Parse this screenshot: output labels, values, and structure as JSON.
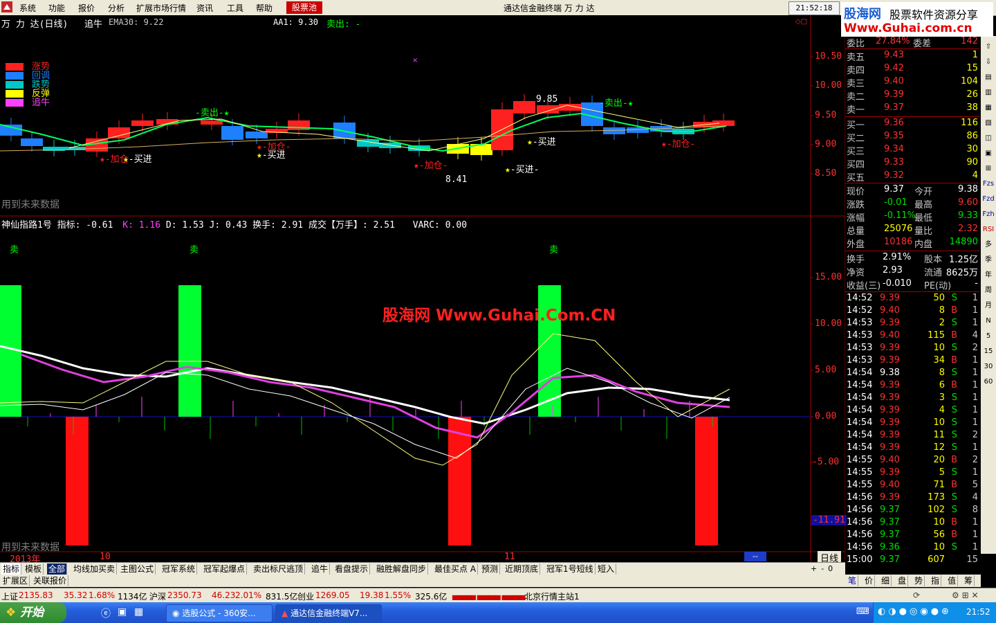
{
  "menu": {
    "items": [
      "系统",
      "功能",
      "报价",
      "分析",
      "扩展市场行情",
      "资讯",
      "工具",
      "帮助"
    ],
    "stock_pool": "股票池",
    "window_title": "通达信金融终端  万 力 达",
    "clock": "21:52:18",
    "logo_cn": "股海网",
    "logo_slogan": "股票软件资源分享",
    "logo_url": "Www.Guhai.com.cn"
  },
  "main_chart": {
    "stock_label": "万 力 达(日线)",
    "indicator_name": "追牛",
    "ema_label": "EMA30: 9.22",
    "aa1_label": "AA1: 9.30",
    "sell_label": "卖出: -",
    "future_data": "用到未来数据",
    "legend": [
      "涨势",
      "回调",
      "跌势",
      "反弹",
      "追牛"
    ],
    "legend_colors": [
      "#ff2020",
      "#1e7fff",
      "#00c8c8",
      "#ffff00",
      "#ff40ff"
    ],
    "annotations": {
      "high": "9.85",
      "low": "8.41",
      "sell": "卖出",
      "buy": "买进",
      "add": "加仓"
    },
    "y_ticks": [
      "10.50",
      "10.00",
      "9.50",
      "9.00",
      "8.50"
    ]
  },
  "sub_chart": {
    "title": "神仙指路1号",
    "indicator": "指标: -0.61",
    "k": "K: 1.16",
    "d": "D: 1.53",
    "j": "J: 0.43",
    "turnover": "换手: 2.91",
    "volume": "成交【万手】: 2.51",
    "varc": "VARC: 0.00",
    "sell_marker": "卖",
    "future_data": "用到未来数据",
    "watermark": "股海网 Www.Guhai.Com.CN",
    "y_ticks": [
      "15.00",
      "10.00",
      "5.00",
      "0.00",
      "-5.00"
    ],
    "current_value": "-11.91"
  },
  "x_axis": {
    "labels": [
      "2013年",
      "10",
      "11"
    ],
    "period": "日线"
  },
  "quote": {
    "weibi_label": "委比",
    "weibi": "27.84%",
    "weicha_label": "委差",
    "weicha": "142",
    "asks": [
      {
        "label": "卖五",
        "price": "9.43",
        "vol": "1"
      },
      {
        "label": "卖四",
        "price": "9.42",
        "vol": "15"
      },
      {
        "label": "卖三",
        "price": "9.40",
        "vol": "104"
      },
      {
        "label": "卖二",
        "price": "9.39",
        "vol": "26"
      },
      {
        "label": "卖一",
        "price": "9.37",
        "vol": "38"
      }
    ],
    "bids": [
      {
        "label": "买一",
        "price": "9.36",
        "vol": "116"
      },
      {
        "label": "买二",
        "price": "9.35",
        "vol": "86"
      },
      {
        "label": "买三",
        "price": "9.34",
        "vol": "30"
      },
      {
        "label": "买四",
        "price": "9.33",
        "vol": "90"
      },
      {
        "label": "买五",
        "price": "9.32",
        "vol": "4"
      }
    ],
    "stats": [
      {
        "l1": "现价",
        "v1": "9.37",
        "c1": "#ffffff",
        "l2": "今开",
        "v2": "9.38",
        "c2": "#ffffff"
      },
      {
        "l1": "涨跌",
        "v1": "-0.01",
        "c1": "#00e000",
        "l2": "最高",
        "v2": "9.60",
        "c2": "#ff3030"
      },
      {
        "l1": "涨幅",
        "v1": "-0.11%",
        "c1": "#00e000",
        "l2": "最低",
        "v2": "9.33",
        "c2": "#00e000"
      },
      {
        "l1": "总量",
        "v1": "25076",
        "c1": "#ffff00",
        "l2": "量比",
        "v2": "2.32",
        "c2": "#ff3030"
      },
      {
        "l1": "外盘",
        "v1": "10186",
        "c1": "#ff3030",
        "l2": "内盘",
        "v2": "14890",
        "c2": "#00e000"
      }
    ],
    "fund": [
      {
        "l1": "换手",
        "v1": "2.91%",
        "l2": "股本",
        "v2": "1.25亿"
      },
      {
        "l1": "净资",
        "v1": "2.93",
        "l2": "流通",
        "v2": "8625万"
      },
      {
        "l1": "收益(三)",
        "v1": "-0.010",
        "l2": "PE(动)",
        "v2": "-"
      }
    ]
  },
  "ticks": [
    {
      "t": "14:52",
      "p": "9.39",
      "v": "50",
      "s": "S",
      "n": "1"
    },
    {
      "t": "14:52",
      "p": "9.40",
      "v": "8",
      "s": "B",
      "n": "1"
    },
    {
      "t": "14:53",
      "p": "9.39",
      "v": "2",
      "s": "S",
      "n": "1"
    },
    {
      "t": "14:53",
      "p": "9.40",
      "v": "115",
      "s": "B",
      "n": "4"
    },
    {
      "t": "14:53",
      "p": "9.39",
      "v": "10",
      "s": "S",
      "n": "2"
    },
    {
      "t": "14:53",
      "p": "9.39",
      "v": "34",
      "s": "B",
      "n": "1"
    },
    {
      "t": "14:54",
      "p": "9.38",
      "v": "8",
      "s": "S",
      "n": "1"
    },
    {
      "t": "14:54",
      "p": "9.39",
      "v": "6",
      "s": "B",
      "n": "1"
    },
    {
      "t": "14:54",
      "p": "9.39",
      "v": "3",
      "s": "S",
      "n": "1"
    },
    {
      "t": "14:54",
      "p": "9.39",
      "v": "4",
      "s": "S",
      "n": "1"
    },
    {
      "t": "14:54",
      "p": "9.39",
      "v": "10",
      "s": "S",
      "n": "1"
    },
    {
      "t": "14:54",
      "p": "9.39",
      "v": "11",
      "s": "S",
      "n": "2"
    },
    {
      "t": "14:54",
      "p": "9.39",
      "v": "12",
      "s": "S",
      "n": "1"
    },
    {
      "t": "14:55",
      "p": "9.40",
      "v": "20",
      "s": "B",
      "n": "2"
    },
    {
      "t": "14:55",
      "p": "9.39",
      "v": "5",
      "s": "S",
      "n": "1"
    },
    {
      "t": "14:55",
      "p": "9.40",
      "v": "71",
      "s": "B",
      "n": "5"
    },
    {
      "t": "14:56",
      "p": "9.39",
      "v": "173",
      "s": "S",
      "n": "4"
    },
    {
      "t": "14:56",
      "p": "9.37",
      "v": "102",
      "s": "S",
      "n": "8"
    },
    {
      "t": "14:56",
      "p": "9.37",
      "v": "10",
      "s": "B",
      "n": "1"
    },
    {
      "t": "14:56",
      "p": "9.37",
      "v": "56",
      "s": "B",
      "n": "1"
    },
    {
      "t": "14:56",
      "p": "9.36",
      "v": "10",
      "s": "S",
      "n": "1"
    },
    {
      "t": "15:00",
      "p": "9.37",
      "v": "607",
      "s": "",
      "n": "15"
    }
  ],
  "sidebar_icons": [
    "Fzs",
    "Fzd",
    "Fzh",
    "RSI",
    "多",
    "季",
    "年",
    "周",
    "月",
    "N",
    "5",
    "15",
    "30",
    "60"
  ],
  "tabs": [
    "指标",
    "模板",
    "全部",
    "均线加买卖",
    "主图公式",
    "冠军系统",
    "冠军起爆点",
    "卖出标尺逃顶",
    "追牛",
    "看盘提示",
    "融胜解盘同步",
    "最佳买点 A",
    "预测",
    "近期顶底",
    "冠军1号短线",
    "短入"
  ],
  "tabs2": [
    "扩展区",
    "关联报价"
  ],
  "right_tabs": [
    "笔",
    "价",
    "细",
    "盘",
    "势",
    "指",
    "值",
    "筹"
  ],
  "status": {
    "sh": "上证",
    "sh_val": "2135.83",
    "sh_chg": "35.32",
    "sh_pct": "1.68%",
    "sh_amt": "1134亿",
    "hs": "沪深",
    "hs_val": "2350.73",
    "hs_chg": "46.23",
    "hs_pct": "2.01%",
    "hs_amt": "831.5亿",
    "cy": "创业",
    "cy_val": "1269.05",
    "cy_chg": "19.38",
    "cy_pct": "1.55%",
    "cy_amt": "325.6亿",
    "server": "北京行情主站1"
  },
  "taskbar": {
    "start": "开始",
    "btn1": "选股公式 - 360安...",
    "btn2": "通达信金融终端V7...",
    "time": "21:52"
  }
}
